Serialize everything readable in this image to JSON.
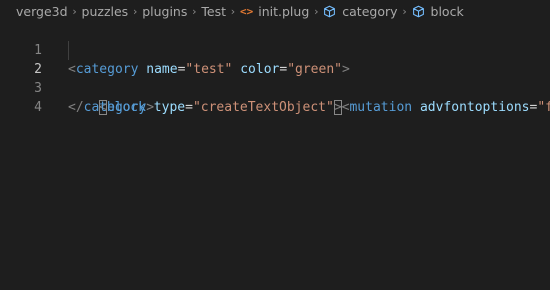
{
  "breadcrumb": {
    "items": [
      {
        "label": "verge3d"
      },
      {
        "label": "puzzles"
      },
      {
        "label": "plugins"
      },
      {
        "label": "Test"
      },
      {
        "label": "init.plug",
        "icon": "xml-file-icon",
        "icon_glyph": "<>"
      },
      {
        "label": "category",
        "icon": "cube-icon"
      },
      {
        "label": "block",
        "icon": "cube-icon"
      }
    ]
  },
  "colors": {
    "background": "#1e1e1e",
    "tag": "#569cd6",
    "attribute": "#9cdcfe",
    "string": "#ce9178",
    "punctuation": "#808080",
    "file_icon": "#e37933",
    "symbol_icon": "#75beff"
  },
  "editor": {
    "active_line": 2,
    "lines": [
      {
        "number": "1",
        "open": "<",
        "tag": "category",
        "attr1": "name",
        "eq1": "=",
        "val1": "\"test\"",
        "attr2": "color",
        "eq2": "=",
        "val2": "\"green\"",
        "close": ">"
      },
      {
        "number": "2",
        "open": "<",
        "tag": "block",
        "attr1": "type",
        "eq1": "=",
        "val1": "\"createTextObject\"",
        "close": ">",
        "open2": "<",
        "tag2": "mutation",
        "attr2": "advfontoptions",
        "eq2": "=",
        "val2": "\"fa"
      },
      {
        "number": "3",
        "open": "</",
        "tag": "category",
        "close": ">"
      },
      {
        "number": "4"
      }
    ]
  }
}
